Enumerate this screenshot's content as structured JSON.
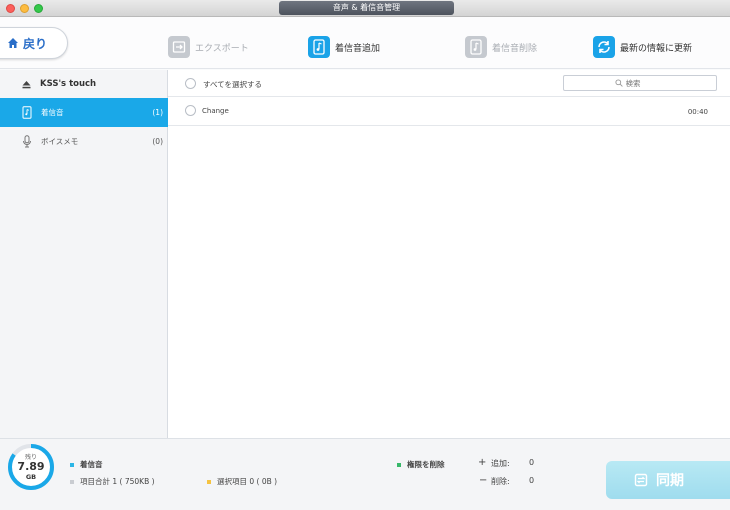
{
  "window": {
    "title": "音声 & 着信音管理"
  },
  "toolbar": {
    "back_label": "戻り",
    "export_label": "エクスポート",
    "add_label": "着信音追加",
    "delete_label": "着信音削除",
    "refresh_label": "最新の情報に更新"
  },
  "sidebar": {
    "device_name": "KSS's touch",
    "items": [
      {
        "label": "着信音",
        "count": "(1)",
        "icon": "ringtone-icon"
      },
      {
        "label": "ボイスメモ",
        "count": "(0)",
        "icon": "microphone-icon"
      }
    ]
  },
  "list": {
    "select_all_label": "すべてを選択する",
    "search_placeholder": "検索",
    "rows": [
      {
        "name": "Change",
        "duration": "00:40"
      }
    ]
  },
  "footer": {
    "storage_label": "残り",
    "storage_value": "7.89",
    "storage_unit": "GB",
    "storage_fraction": 0.85,
    "legend_ringtone": "着信音",
    "legend_total": "項目合計 1 ( 750KB )",
    "legend_selected": "選択項目 0 ( 0B )",
    "legend_delete_perm": "権限を削除",
    "add_label": "追加:",
    "add_value": "0",
    "delete_label": "削除:",
    "delete_value": "0",
    "sync_label": "同期"
  },
  "colors": {
    "accent": "#1aa8e8",
    "ringtone_legend": "#2bb6e6",
    "selected_legend": "#f5c342",
    "delete_perm_legend": "#37b86a",
    "total_legend": "#c9ccd1"
  }
}
